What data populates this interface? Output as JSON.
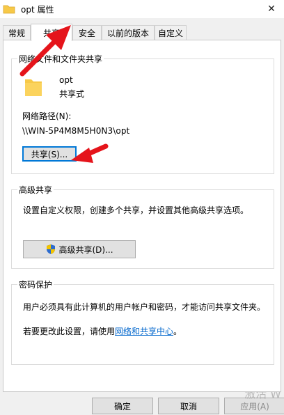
{
  "window": {
    "title": "opt 属性",
    "close_glyph": "✕"
  },
  "tabs": [
    {
      "label": "常规"
    },
    {
      "label": "共享"
    },
    {
      "label": "安全"
    },
    {
      "label": "以前的版本"
    },
    {
      "label": "自定义"
    }
  ],
  "network_sharing": {
    "legend": "网络文件和文件夹共享",
    "share_name": "opt",
    "share_state": "共享式",
    "path_label": "网络路径(N):",
    "path_value": "\\\\WIN-5P4M8M5H0N3\\opt",
    "share_button": "共享(S)..."
  },
  "advanced_sharing": {
    "legend": "高级共享",
    "description": "设置自定义权限，创建多个共享，并设置其他高级共享选项。",
    "button": "高级共享(D)..."
  },
  "password_protection": {
    "legend": "密码保护",
    "description": "用户必须具有此计算机的用户帐户和密码，才能访问共享文件夹。",
    "change_prefix": "若要更改此设置，请使用",
    "change_link": "网络和共享中心",
    "change_suffix": "。"
  },
  "footer": {
    "ok": "确定",
    "cancel": "取消",
    "apply": "应用(A)"
  },
  "watermark": "激活 W",
  "colors": {
    "arrow": "#e5141b",
    "folder": "#f7c948",
    "link": "#0066cc",
    "focus_border": "#0078d7"
  }
}
